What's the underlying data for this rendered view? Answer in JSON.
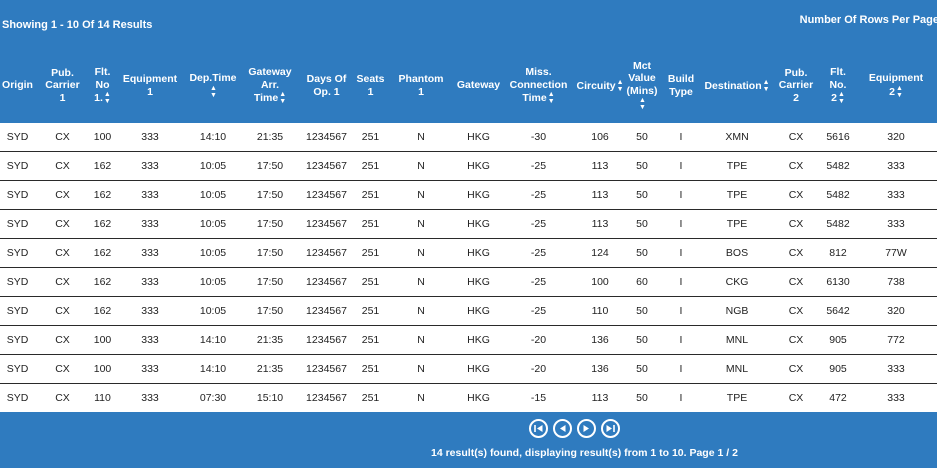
{
  "header": {
    "showing": "Showing 1 - 10 Of 14 Results",
    "rows_per_page_label": "Number Of Rows Per Page"
  },
  "columns": [
    {
      "key": "origin",
      "label": "Origin",
      "lines": [
        "Origin"
      ],
      "sortable": false
    },
    {
      "key": "pub_carrier_1",
      "label": "Pub. Carrier 1",
      "lines": [
        "Pub.",
        "Carrier",
        "1"
      ],
      "sortable": false
    },
    {
      "key": "flt_no_1",
      "label": "Flt. No 1.",
      "lines": [
        "Flt.",
        "No",
        "1."
      ],
      "sortable": true
    },
    {
      "key": "equipment_1",
      "label": "Equipment 1",
      "lines": [
        "Equipment",
        "1"
      ],
      "sortable": false
    },
    {
      "key": "dep_time",
      "label": "Dep.Time",
      "lines": [
        "Dep.Time"
      ],
      "sortable": true
    },
    {
      "key": "gateway_arr_time",
      "label": "Gateway Arr. Time",
      "lines": [
        "Gateway",
        "Arr.",
        "Time"
      ],
      "sortable": true
    },
    {
      "key": "days_of_op_1",
      "label": "Days Of Op. 1",
      "lines": [
        "Days Of",
        "Op. 1"
      ],
      "sortable": false
    },
    {
      "key": "seats_1",
      "label": "Seats 1",
      "lines": [
        "Seats",
        "1"
      ],
      "sortable": false
    },
    {
      "key": "phantom_1",
      "label": "Phantom 1",
      "lines": [
        "Phantom",
        "1"
      ],
      "sortable": false
    },
    {
      "key": "gateway",
      "label": "Gateway",
      "lines": [
        "Gateway"
      ],
      "sortable": false
    },
    {
      "key": "miss_connection_time",
      "label": "Miss. Connection Time",
      "lines": [
        "Miss.",
        "Connection",
        "Time"
      ],
      "sortable": true
    },
    {
      "key": "circuity",
      "label": "Circuity",
      "lines": [
        "Circuity"
      ],
      "sortable": true
    },
    {
      "key": "mct_value",
      "label": "Mct Value (Mins)",
      "lines": [
        "Mct",
        "Value",
        "(Mins)"
      ],
      "sortable": true
    },
    {
      "key": "build_type",
      "label": "Build Type",
      "lines": [
        "Build",
        "Type"
      ],
      "sortable": false
    },
    {
      "key": "destination",
      "label": "Destination",
      "lines": [
        "Destination"
      ],
      "sortable": true
    },
    {
      "key": "pub_carrier_2",
      "label": "Pub. Carrier 2",
      "lines": [
        "Pub.",
        "Carrier",
        "2"
      ],
      "sortable": false
    },
    {
      "key": "flt_no_2",
      "label": "Flt. No. 2",
      "lines": [
        "Flt.",
        "No.",
        "2"
      ],
      "sortable": true
    },
    {
      "key": "equipment_2",
      "label": "Equipment 2",
      "lines": [
        "Equipment",
        "2"
      ],
      "sortable": true
    }
  ],
  "rows": [
    [
      "SYD",
      "CX",
      "100",
      "333",
      "14:10",
      "21:35",
      "1234567",
      "251",
      "N",
      "HKG",
      "-30",
      "106",
      "50",
      "I",
      "XMN",
      "CX",
      "5616",
      "320"
    ],
    [
      "SYD",
      "CX",
      "162",
      "333",
      "10:05",
      "17:50",
      "1234567",
      "251",
      "N",
      "HKG",
      "-25",
      "113",
      "50",
      "I",
      "TPE",
      "CX",
      "5482",
      "333"
    ],
    [
      "SYD",
      "CX",
      "162",
      "333",
      "10:05",
      "17:50",
      "1234567",
      "251",
      "N",
      "HKG",
      "-25",
      "113",
      "50",
      "I",
      "TPE",
      "CX",
      "5482",
      "333"
    ],
    [
      "SYD",
      "CX",
      "162",
      "333",
      "10:05",
      "17:50",
      "1234567",
      "251",
      "N",
      "HKG",
      "-25",
      "113",
      "50",
      "I",
      "TPE",
      "CX",
      "5482",
      "333"
    ],
    [
      "SYD",
      "CX",
      "162",
      "333",
      "10:05",
      "17:50",
      "1234567",
      "251",
      "N",
      "HKG",
      "-25",
      "124",
      "50",
      "I",
      "BOS",
      "CX",
      "812",
      "77W"
    ],
    [
      "SYD",
      "CX",
      "162",
      "333",
      "10:05",
      "17:50",
      "1234567",
      "251",
      "N",
      "HKG",
      "-25",
      "100",
      "60",
      "I",
      "CKG",
      "CX",
      "6130",
      "738"
    ],
    [
      "SYD",
      "CX",
      "162",
      "333",
      "10:05",
      "17:50",
      "1234567",
      "251",
      "N",
      "HKG",
      "-25",
      "110",
      "50",
      "I",
      "NGB",
      "CX",
      "5642",
      "320"
    ],
    [
      "SYD",
      "CX",
      "100",
      "333",
      "14:10",
      "21:35",
      "1234567",
      "251",
      "N",
      "HKG",
      "-20",
      "136",
      "50",
      "I",
      "MNL",
      "CX",
      "905",
      "772"
    ],
    [
      "SYD",
      "CX",
      "100",
      "333",
      "14:10",
      "21:35",
      "1234567",
      "251",
      "N",
      "HKG",
      "-20",
      "136",
      "50",
      "I",
      "MNL",
      "CX",
      "905",
      "333"
    ],
    [
      "SYD",
      "CX",
      "110",
      "333",
      "07:30",
      "15:10",
      "1234567",
      "251",
      "N",
      "HKG",
      "-15",
      "113",
      "50",
      "I",
      "TPE",
      "CX",
      "472",
      "333"
    ]
  ],
  "pagination": {
    "buttons": [
      {
        "name": "first-page-button",
        "icon": "first-page-icon"
      },
      {
        "name": "previous-page-button",
        "icon": "previous-page-icon"
      },
      {
        "name": "next-page-button",
        "icon": "next-page-icon"
      },
      {
        "name": "last-page-button",
        "icon": "last-page-icon"
      }
    ],
    "summary": "14 result(s) found, displaying result(s) from 1 to 10. Page 1 / 2"
  },
  "colors": {
    "header_blue": "#2f7bbf",
    "row_border": "#2a2a2a"
  }
}
